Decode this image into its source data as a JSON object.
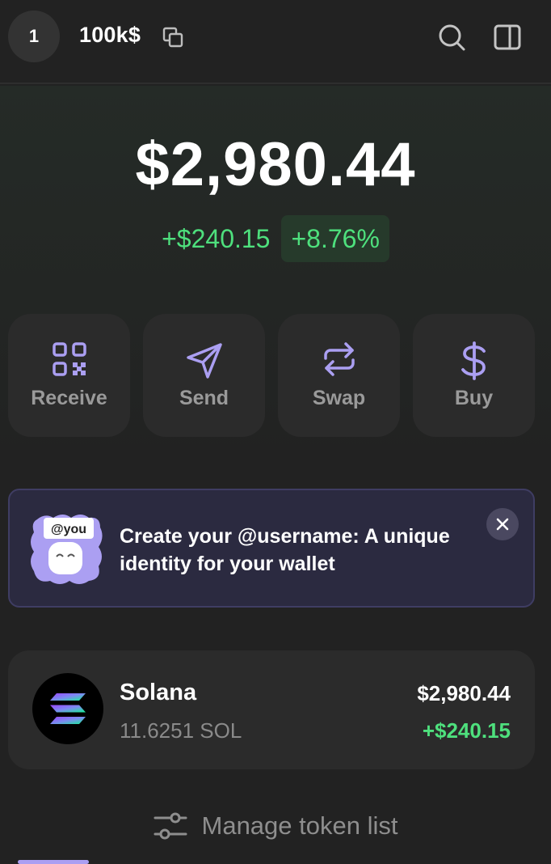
{
  "header": {
    "avatar_initial": "1",
    "account_name": "100k$",
    "icons": [
      "copy-icon",
      "search-icon",
      "sidebar-panel-icon"
    ]
  },
  "balance": {
    "total": "$2,980.44",
    "change_amount": "+$240.15",
    "change_percent": "+8.76%"
  },
  "actions": [
    {
      "label": "Receive",
      "icon": "qr-code-icon"
    },
    {
      "label": "Send",
      "icon": "paper-plane-icon"
    },
    {
      "label": "Swap",
      "icon": "swap-arrows-icon"
    },
    {
      "label": "Buy",
      "icon": "dollar-icon"
    }
  ],
  "banner": {
    "text": "Create your @username: A unique identity for your wallet",
    "art_badge": "@you"
  },
  "tokens": [
    {
      "name": "Solana",
      "amount": "11.6251 SOL",
      "value": "$2,980.44",
      "change": "+$240.15"
    }
  ],
  "manage": {
    "label": "Manage token list"
  },
  "colors": {
    "background": "#222222",
    "card": "#2b2b2b",
    "accent": "#ab9ff2",
    "positive": "#4ee07d",
    "banner": "#2b2a40"
  }
}
